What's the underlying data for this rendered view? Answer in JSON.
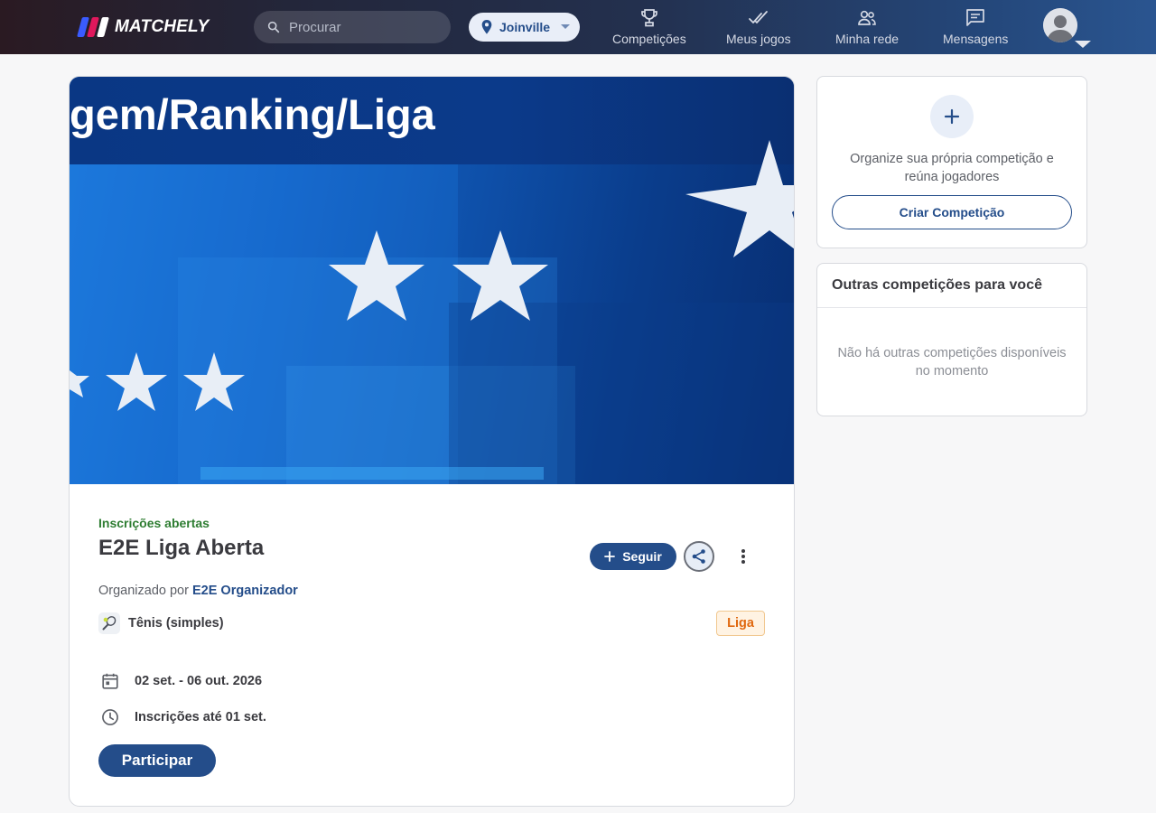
{
  "app": {
    "name": "MATCHELY"
  },
  "header": {
    "search_placeholder": "Procurar",
    "location": "Joinville",
    "nav": [
      {
        "label": "Competições",
        "icon": "trophy-icon"
      },
      {
        "label": "Meus jogos",
        "icon": "double-check-icon"
      },
      {
        "label": "Minha rede",
        "icon": "people-icon"
      },
      {
        "label": "Mensagens",
        "icon": "chat-icon"
      }
    ]
  },
  "competition": {
    "banner_text": "gem/Ranking/Liga",
    "status": "Inscrições abertas",
    "title": "E2E Liga Aberta",
    "follow_label": "Seguir",
    "organized_by_prefix": "Organizado por",
    "organizer": "E2E Organizador",
    "sport": "Tênis (simples)",
    "type_tag": "Liga",
    "dates": "02 set. - 06 out. 2026",
    "registration_deadline": "Inscrições até 01 set.",
    "join_label": "Participar"
  },
  "sidebar": {
    "create": {
      "text": "Organize sua própria competição e reúna jogadores",
      "button_label": "Criar Competição"
    },
    "other": {
      "title": "Outras competições para você",
      "empty_text": "Não há outras competições disponíveis no momento"
    }
  },
  "colors": {
    "primary": "#244d8a",
    "status_green": "#2e7d32",
    "tag_orange": "#e0680f",
    "tag_bg": "#fff3e3"
  }
}
